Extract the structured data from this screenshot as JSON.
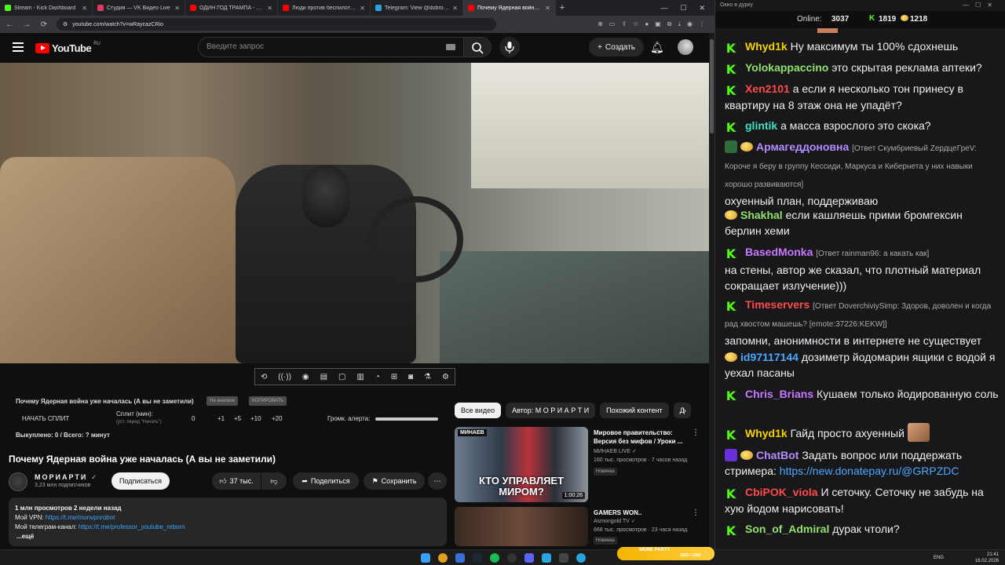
{
  "browser": {
    "tabs": [
      {
        "label": "Stream - Kick Dashboard",
        "color": "#53fc18"
      },
      {
        "label": "Студия — VK Видео Live",
        "color": "#e03a58"
      },
      {
        "label": "ОДИН ГОД ТРАМПА - YouTube",
        "color": "#ff0000"
      },
      {
        "label": "Люди против беспилотник сем",
        "color": "#ff0000"
      },
      {
        "label": "Telegram: View @dobro_2ch",
        "color": "#2aa3df"
      },
      {
        "label": "Почему Ядерная война уже",
        "color": "#ff0000"
      }
    ],
    "url": "youtube.com/watch?v=wRaycazCRio"
  },
  "youtube": {
    "logo_text": "YouTube",
    "logo_region": "RU",
    "search_placeholder": "Введите запрос",
    "create_label": "Создать"
  },
  "extension": {
    "video_title": "Почему Ядерная война уже началась (А вы не заметили)",
    "chip_analysis": "На анализе",
    "chip_copy": "КОПИРОВАТЬ",
    "start_split": "НАЧАТЬ СПЛИТ",
    "split_label": "Сплит (мин):",
    "split_hint": "(уст. перед \"Начать\")",
    "split_values": [
      "0",
      "+1",
      "+5",
      "+10",
      "+20"
    ],
    "alert_volume_label": "Громк. алерта:",
    "alert_volume": 1.0,
    "paid_status": "Выкуплено: 0 / Всего: ? минут"
  },
  "video": {
    "title": "Почему Ядерная война уже началась (А вы не заметили)",
    "channel": "МОРИАРТИ",
    "subscribers": "3,23 млн подписчиков",
    "subscribe_label": "Подписаться",
    "likes": "37 тыс.",
    "share_label": "Поделиться",
    "save_label": "Сохранить",
    "desc_stats": "1 млн просмотров  2 недели назад",
    "desc_vpn_label": "Мой VPN: ",
    "desc_vpn_link": "https://t.me/monvpnrobot",
    "desc_tg_label": "Мой телеграм-канал: ",
    "desc_tg_link": "https://t.me/professor_youtube_reborn",
    "desc_more": "...ещё"
  },
  "related": {
    "filters": [
      "Все видео",
      "Автор: М О Р И А Р Т И",
      "Похожий контент",
      "Д"
    ],
    "items": [
      {
        "title": "Мировое правительство: Версия без мифов / Уроки ...",
        "channel": "МИНАЕВ LIVE",
        "meta": "160 тыс. просмотров · 7 часов назад",
        "badge": "Новинка",
        "duration": "1:00:26",
        "thumb_top": "МИНАЕВ",
        "thumb_text": "КТО УПРАВЛЯЕТ МИРОМ?"
      },
      {
        "title": "GAMERS WON..",
        "channel": "Asmongold TV",
        "meta": "668 тыс. просмотров · 23 часа назад",
        "badge": "Новинка",
        "duration": "",
        "thumb_top": "",
        "thumb_text": ""
      }
    ]
  },
  "chat": {
    "title": "Окно в дурку",
    "online_label": "Online:",
    "online_count": "3037",
    "stat_1": "1819",
    "stat_2": "1218",
    "messages": [
      {
        "user": "Whyd1k",
        "color": "#f5d300",
        "text": "Ну максимум ты 100% сдохнешь"
      },
      {
        "user": "Yolokappaccino",
        "color": "#93e06a",
        "text": "это скрытая реклама аптеки?"
      },
      {
        "user": "Xen2101",
        "color": "#ff4a4a",
        "text": "а если я несколько тон принесу в квартиру на 8 этаж она не упадёт?"
      },
      {
        "user": "glintik",
        "color": "#3fe0c5",
        "text": "а масса взрослого это скока?"
      },
      {
        "user": "Армагеддоновна",
        "color": "#b58cff",
        "reply": "[Ответ Скумбриевый ZердцеГреV: Короче я беру в группу Кессиди, Маркуса и Кибернета у них навыки хорошо развиваются]",
        "text": "охуенный план, поддерживаю"
      },
      {
        "user": "Shakhal",
        "color": "#93e06a",
        "text": "если кашляешь прими бромгексин берлин хеми"
      },
      {
        "user": "BasedMonka",
        "color": "#c678ff",
        "reply": "[Ответ rainman96: а какать как]",
        "text": "на стены, автор же сказал, что плотный материал сокращает излучение)))"
      },
      {
        "user": "Timeservers",
        "color": "#ff4a4a",
        "reply": "[Ответ DoverchiviySimp: Здоров, доволен и когда рад хвостом машешь? [emote:37226:KEKW]]",
        "text": "запомни, анонимности в интернете не существует"
      },
      {
        "user": "id97117144",
        "color": "#4aa8ff",
        "text": "дозиметр йодомарин ящики с водой я уехал пасаны"
      },
      {
        "user": "Chris_Brians",
        "color": "#c678ff",
        "text": "Кушаем только йодированную соль"
      },
      {
        "user": "Whyd1k",
        "color": "#f5d300",
        "text": "Гайд просто ахуенный"
      },
      {
        "user": "ChatBot",
        "color": "#b58cff",
        "text": "Задать вопрос или поддержать стримера: ",
        "link": "https://new.donatepay.ru/@GRPZDC"
      },
      {
        "user": "CbiPOK_viola",
        "color": "#ff4a4a",
        "text": "И сеточку. Сеточку не забудь на хую йодом нарисовать!"
      },
      {
        "user": "Son_of_Admiral",
        "color": "#93e06a",
        "text": "дурак чтоли?"
      }
    ]
  },
  "taskbar": {
    "meme_party": "MEME PARTY",
    "meme_count": "1500 / 1500",
    "lang": "ENG",
    "time": "21:41",
    "date": "16.02.2026"
  }
}
